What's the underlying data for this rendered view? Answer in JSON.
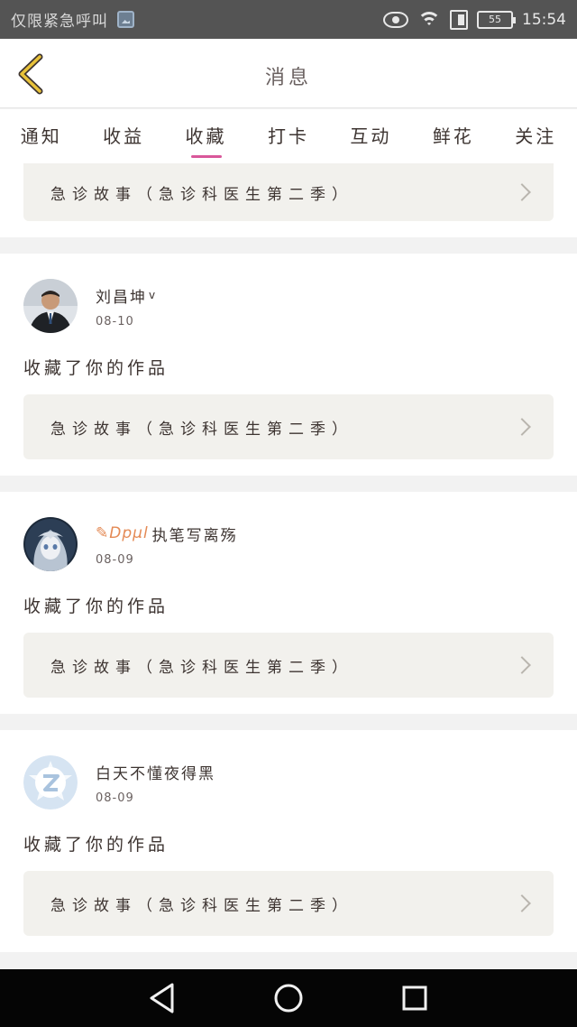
{
  "status_bar": {
    "left_text": "仅限紧急呼叫",
    "battery": "55",
    "time": "15:54"
  },
  "header": {
    "title": "消息"
  },
  "tabs": [
    {
      "label": "通知",
      "active": false
    },
    {
      "label": "收益",
      "active": false
    },
    {
      "label": "收藏",
      "active": true
    },
    {
      "label": "打卡",
      "active": false
    },
    {
      "label": "互动",
      "active": false
    },
    {
      "label": "鲜花",
      "active": false
    },
    {
      "label": "关注",
      "active": false
    }
  ],
  "feed": {
    "partial_card": {
      "work_title": "急诊故事（急诊科医生第二季）"
    },
    "items": [
      {
        "user_name": "刘昌坤",
        "verified": "v",
        "date": "08-10",
        "action": "收藏了你的作品",
        "work_title": "急诊故事（急诊科医生第二季）"
      },
      {
        "user_prefix": "✎Dpμl",
        "user_name": "执笔写离殇",
        "date": "08-09",
        "action": "收藏了你的作品",
        "work_title": "急诊故事（急诊科医生第二季）"
      },
      {
        "user_name": "白天不懂夜得黑",
        "date": "08-09",
        "action": "收藏了你的作品",
        "work_title": "急诊故事（急诊科医生第二季）"
      }
    ]
  },
  "colors": {
    "accent": "#d9579a",
    "back_arrow": "#e8c23a",
    "card_box": "#f2f1ed"
  }
}
